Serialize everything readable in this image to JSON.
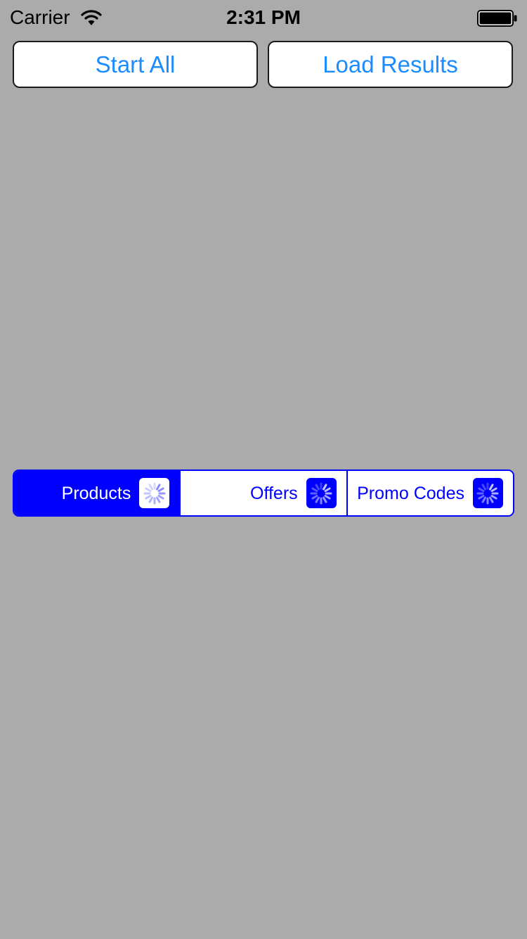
{
  "status_bar": {
    "carrier": "Carrier",
    "time": "2:31 PM",
    "wifi_icon": "wifi-icon",
    "battery_icon": "battery-icon"
  },
  "toolbar": {
    "start_all_label": "Start All",
    "load_results_label": "Load Results"
  },
  "segmented_control": {
    "selected_index": 0,
    "segments": [
      {
        "label": "Products",
        "icon": "spinner-icon"
      },
      {
        "label": "Offers",
        "icon": "spinner-icon"
      },
      {
        "label": "Promo Codes",
        "icon": "spinner-icon"
      }
    ]
  },
  "colors": {
    "background": "#ababab",
    "accent": "#0000ff",
    "button_text": "#1a8cff"
  }
}
